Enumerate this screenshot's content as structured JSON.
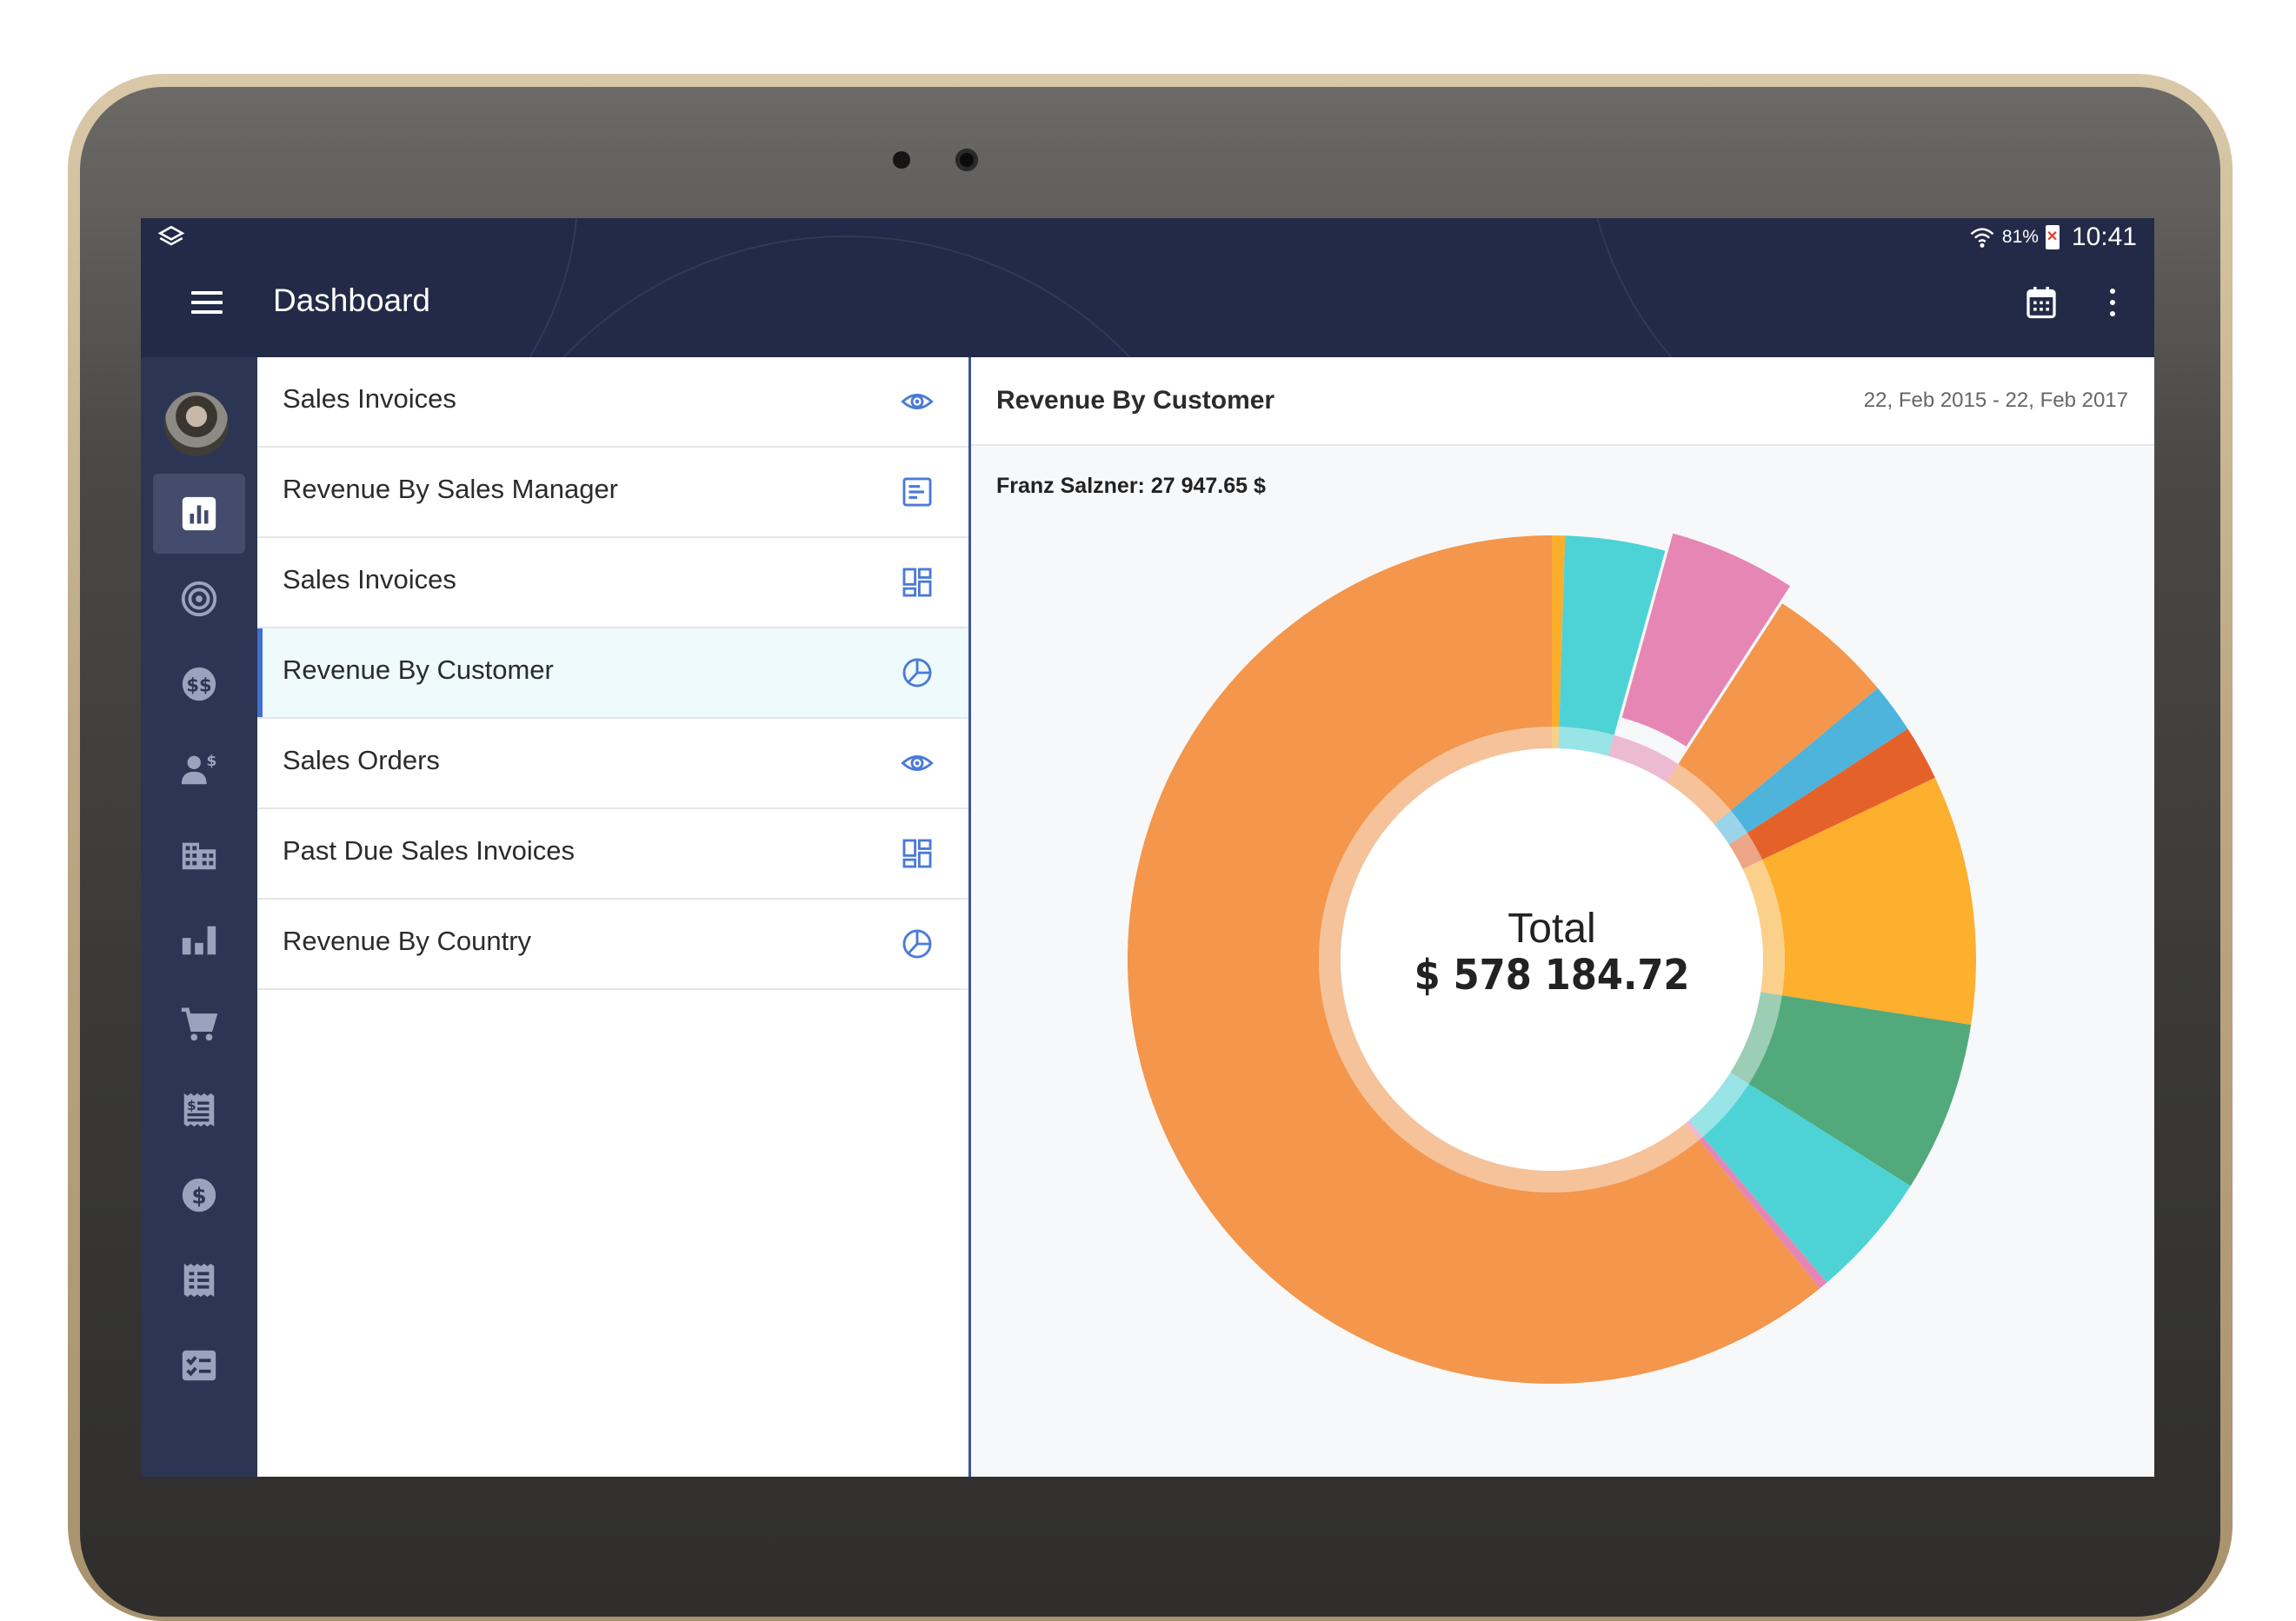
{
  "status_bar": {
    "battery": "81%",
    "time": "10:41"
  },
  "app_bar": {
    "title": "Dashboard"
  },
  "sidebar": {
    "icons": [
      "analytics-icon",
      "target-icon",
      "currency-exchange-icon",
      "customer-payment-icon",
      "building-icon",
      "bar-chart-icon",
      "cart-icon",
      "receipt-icon",
      "dollar-badge-icon",
      "list-document-icon",
      "checklist-icon"
    ]
  },
  "menu": {
    "items": [
      {
        "label": "Sales Invoices",
        "icon": "eye-icon"
      },
      {
        "label": "Revenue By Sales Manager",
        "icon": "bar-list-icon"
      },
      {
        "label": "Sales Invoices",
        "icon": "grid-icon"
      },
      {
        "label": "Revenue By Customer",
        "icon": "pie-icon",
        "selected": true
      },
      {
        "label": "Sales Orders",
        "icon": "eye-icon"
      },
      {
        "label": "Past Due Sales Invoices",
        "icon": "grid-icon"
      },
      {
        "label": "Revenue By Country",
        "icon": "pie-icon"
      }
    ]
  },
  "detail": {
    "title": "Revenue By Customer",
    "date_range": "22, Feb 2015 - 22, Feb 2017",
    "hover_label": "Franz Salzner: 27 947.65 $",
    "total_label": "Total",
    "total_value": "$ 578 184.72"
  },
  "chart_data": {
    "type": "pie",
    "donut": true,
    "title": "",
    "slices": [
      {
        "value": 0.5,
        "color": "#fbae2c"
      },
      {
        "value": 3.8,
        "color": "#4dd3d6"
      },
      {
        "value": 4.83,
        "color": "#e686b4",
        "highlighted": true
      },
      {
        "value": 4.8,
        "color": "#f4964b"
      },
      {
        "value": 1.9,
        "color": "#4eb4dc"
      },
      {
        "value": 2.1,
        "color": "#e5612a"
      },
      {
        "value": 9.5,
        "color": "#fdaf2e"
      },
      {
        "value": 6.5,
        "color": "#52a97b"
      },
      {
        "value": 4.8,
        "color": "#4dd3d6"
      },
      {
        "value": 0.35,
        "color": "#e686b4"
      },
      {
        "value": 60.82,
        "color": "#f4964b"
      }
    ],
    "colors": {
      "accent": "#3f6fd1",
      "appbar": "#222a47",
      "rail": "#2c3553"
    }
  }
}
